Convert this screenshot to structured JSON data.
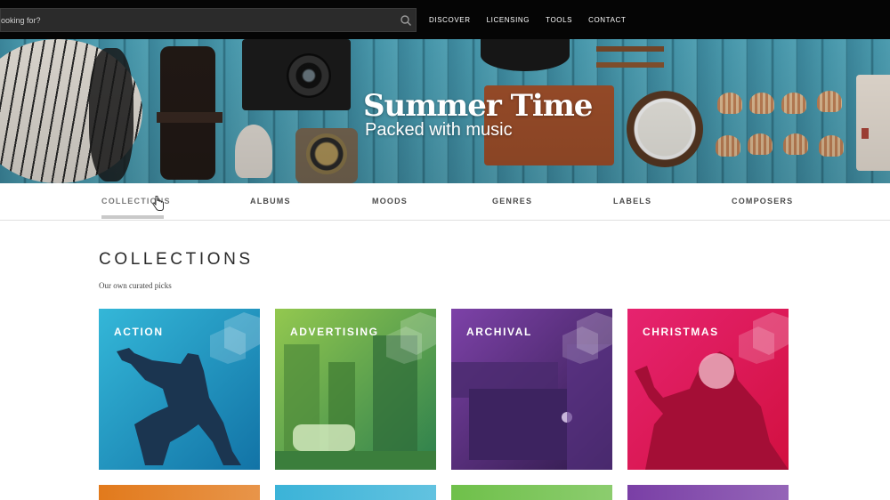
{
  "search": {
    "placeholder": "ooking for?"
  },
  "nav": {
    "items": [
      "DISCOVER",
      "LICENSING",
      "TOOLS",
      "CONTACT"
    ]
  },
  "hero": {
    "title": "Summer Time",
    "subtitle": "Packed with music"
  },
  "tabs": [
    "COLLECTIONS",
    "ALBUMS",
    "MOODS",
    "GENRES",
    "LABELS",
    "COMPOSERS"
  ],
  "section": {
    "title": "COLLECTIONS",
    "subtitle": "Our own curated picks"
  },
  "cards": [
    {
      "label": "ACTION",
      "color_top": "#2fb3d6",
      "color_bottom": "#1679a8"
    },
    {
      "label": "ADVERTISING",
      "color_top": "#8bc34a",
      "color_bottom": "#2e8b57"
    },
    {
      "label": "ARCHIVAL",
      "color_top": "#7b3fa3",
      "color_bottom": "#3a1e5c"
    },
    {
      "label": "CHRISTMAS",
      "color_top": "#e4206a",
      "color_bottom": "#d01240"
    }
  ],
  "row2_colors": [
    "#e27a1c",
    "#3bb3d8",
    "#6fc04a",
    "#7a3fa6"
  ],
  "icons": [
    "search-icon",
    "pointer-cursor-icon",
    "collection-logo-icon"
  ]
}
